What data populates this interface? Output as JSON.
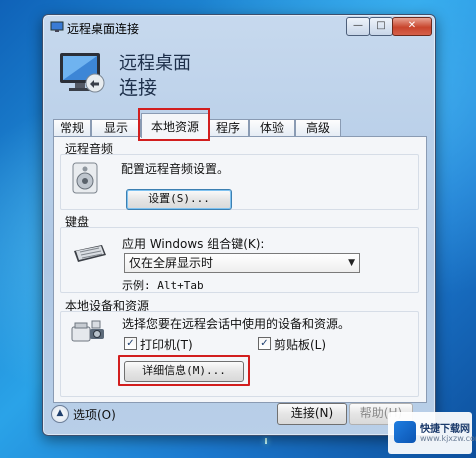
{
  "window": {
    "title": "远程桌面连接",
    "header_line1": "远程桌面",
    "header_line2": "连接"
  },
  "title_controls": {
    "minimize": "—",
    "maximize": "□",
    "close": "✕"
  },
  "tabs": [
    {
      "label": "常规"
    },
    {
      "label": "显示"
    },
    {
      "label": "本地资源",
      "active": true
    },
    {
      "label": "程序"
    },
    {
      "label": "体验"
    },
    {
      "label": "高级"
    }
  ],
  "audio": {
    "group_title": "远程音频",
    "description": "配置远程音频设置。",
    "settings_button": "设置(S)..."
  },
  "keyboard": {
    "group_title": "键盘",
    "apply_label": "应用 Windows 组合键(K):",
    "selected_option": "仅在全屏显示时",
    "example_label": "示例: Alt+Tab"
  },
  "devices": {
    "group_title": "本地设备和资源",
    "description": "选择您要在远程会话中使用的设备和资源。",
    "printer": {
      "label": "打印机(T)",
      "checked": true
    },
    "clipboard": {
      "label": "剪贴板(L)",
      "checked": true
    },
    "details_button": "详细信息(M)..."
  },
  "footer": {
    "options_label": "选项(O)",
    "connect_button": "连接(N)",
    "help_button": "帮助(H)"
  },
  "watermark": {
    "text": "快捷下载网",
    "sub": "www.kjxzw.com"
  },
  "icons": {
    "title_icon": "monitor-icon",
    "header_icon": "remote-desktop-monitor-icon",
    "audio_icon": "speaker-icon",
    "keyboard_icon": "keyboard-icon",
    "devices_icon": "devices-icon",
    "options_icon": "chevron-up-circle-icon"
  },
  "colors": {
    "highlight_red": "#d21e1e",
    "window_frame": "#aec7e4",
    "panel_bg": "#f4f6f9"
  }
}
